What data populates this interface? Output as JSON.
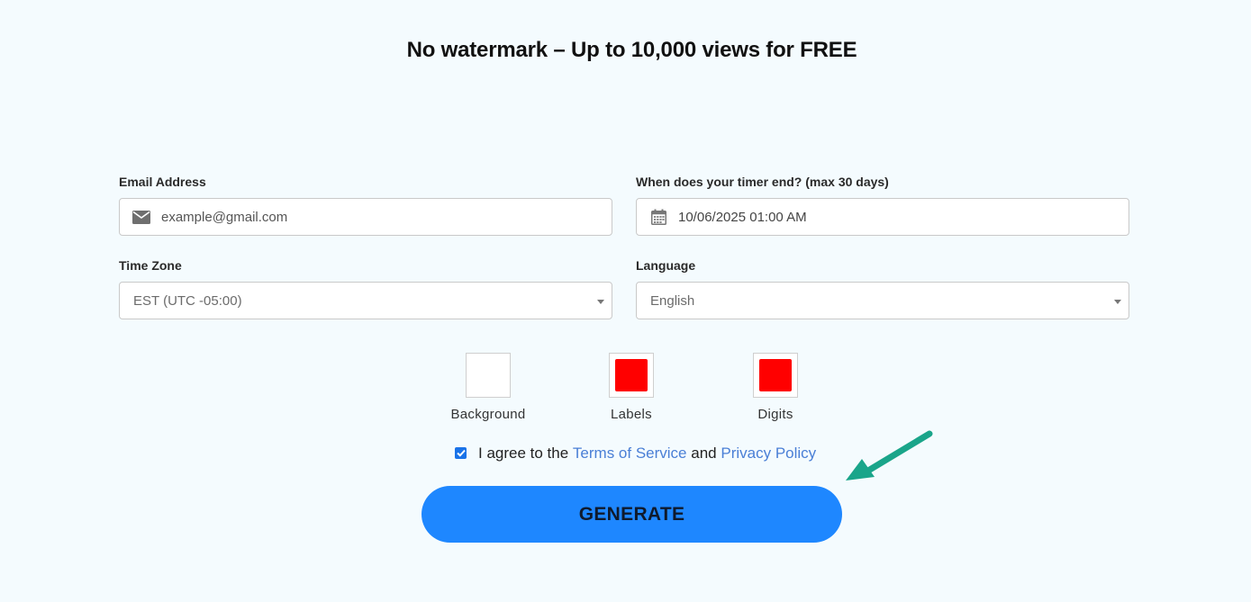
{
  "headline": "No watermark – Up to 10,000 views for FREE",
  "form": {
    "email": {
      "label": "Email Address",
      "placeholder": "example@gmail.com",
      "icon": "envelope-icon"
    },
    "end_time": {
      "label": "When does your timer end? (max 30 days)",
      "value": "10/06/2025 01:00 AM",
      "icon": "calendar-icon"
    },
    "time_zone": {
      "label": "Time Zone",
      "selected": "EST (UTC -05:00)"
    },
    "language": {
      "label": "Language",
      "selected": "English"
    }
  },
  "colors": {
    "swatches": [
      {
        "label": "Background",
        "color": "#ffffff"
      },
      {
        "label": "Labels",
        "color": "#ff0000"
      },
      {
        "label": "Digits",
        "color": "#ff0000"
      }
    ],
    "primary_button": "#1e87ff",
    "link": "#4a7fd6",
    "annotation_arrow": "#1aa58a"
  },
  "agreement": {
    "checked": true,
    "prefix": "I agree to the",
    "terms_link": "Terms of Service",
    "conjunction": "and",
    "privacy_link": "Privacy Policy"
  },
  "generate_button": {
    "label": "GENERATE"
  }
}
